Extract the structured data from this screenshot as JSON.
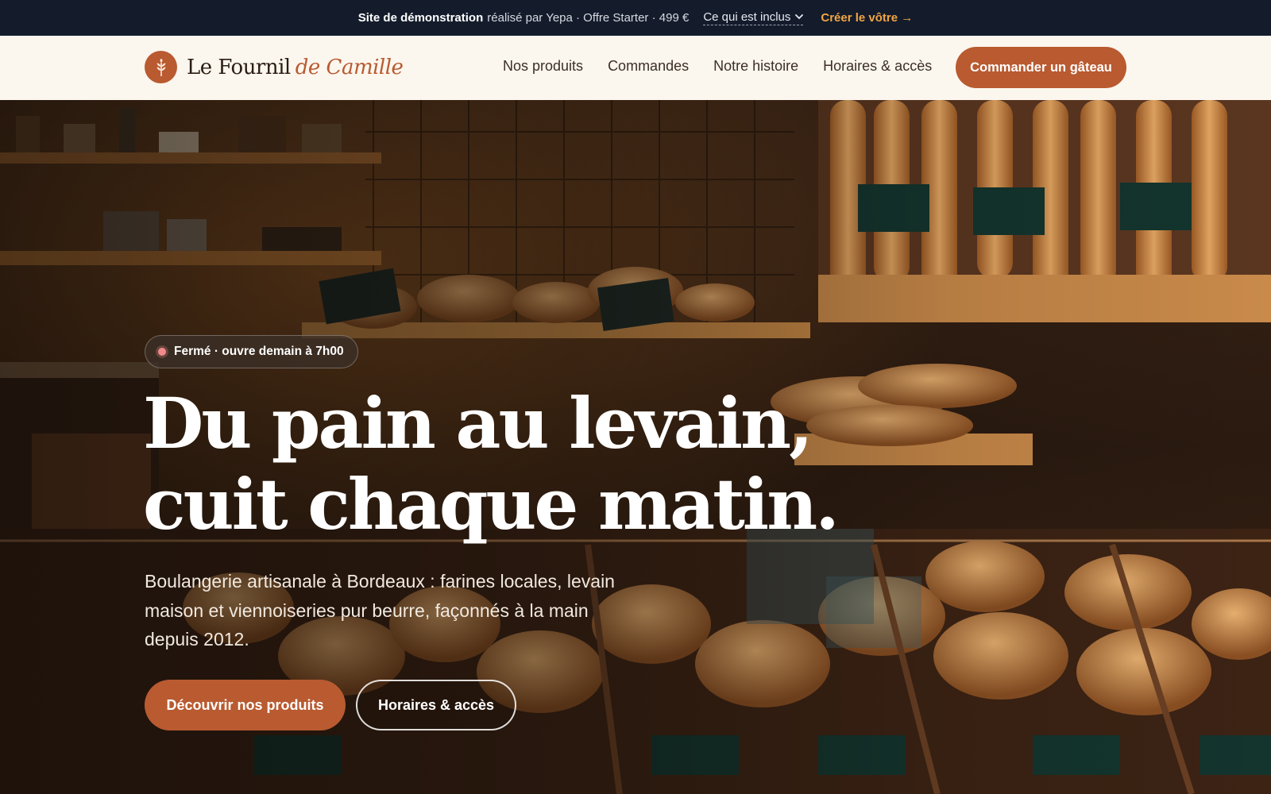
{
  "banner": {
    "strong": "Site de démonstration",
    "text": "réalisé par Yepa · Offre Starter · 499 €",
    "included": "Ce qui est inclus",
    "create": "Créer le vôtre →"
  },
  "header": {
    "brand_main": "Le Fournil",
    "brand_accent": "de Camille",
    "nav": [
      "Nos produits",
      "Commandes",
      "Notre histoire",
      "Horaires & accès"
    ],
    "cta": "Commander un gâteau"
  },
  "hero": {
    "status": "Fermé · ouvre demain à 7h00",
    "title_line1": "Du pain au levain,",
    "title_line2": "cuit chaque matin.",
    "subtitle": "Boulangerie artisanale à Bordeaux : farines locales, levain maison et viennoiseries pur beurre, façonnés à la main depuis 2012.",
    "primary_button": "Découvrir nos produits",
    "secondary_button": "Horaires & accès"
  },
  "colors": {
    "banner_bg": "#141c2c",
    "banner_link": "#f2a541",
    "header_bg": "#fbf6ee",
    "brand": "#b95a30",
    "status_dot": "#f08a8a"
  },
  "icons": {
    "logo": "wheat-icon",
    "dropdown": "chevron-down-icon",
    "status": "status-dot-icon"
  }
}
